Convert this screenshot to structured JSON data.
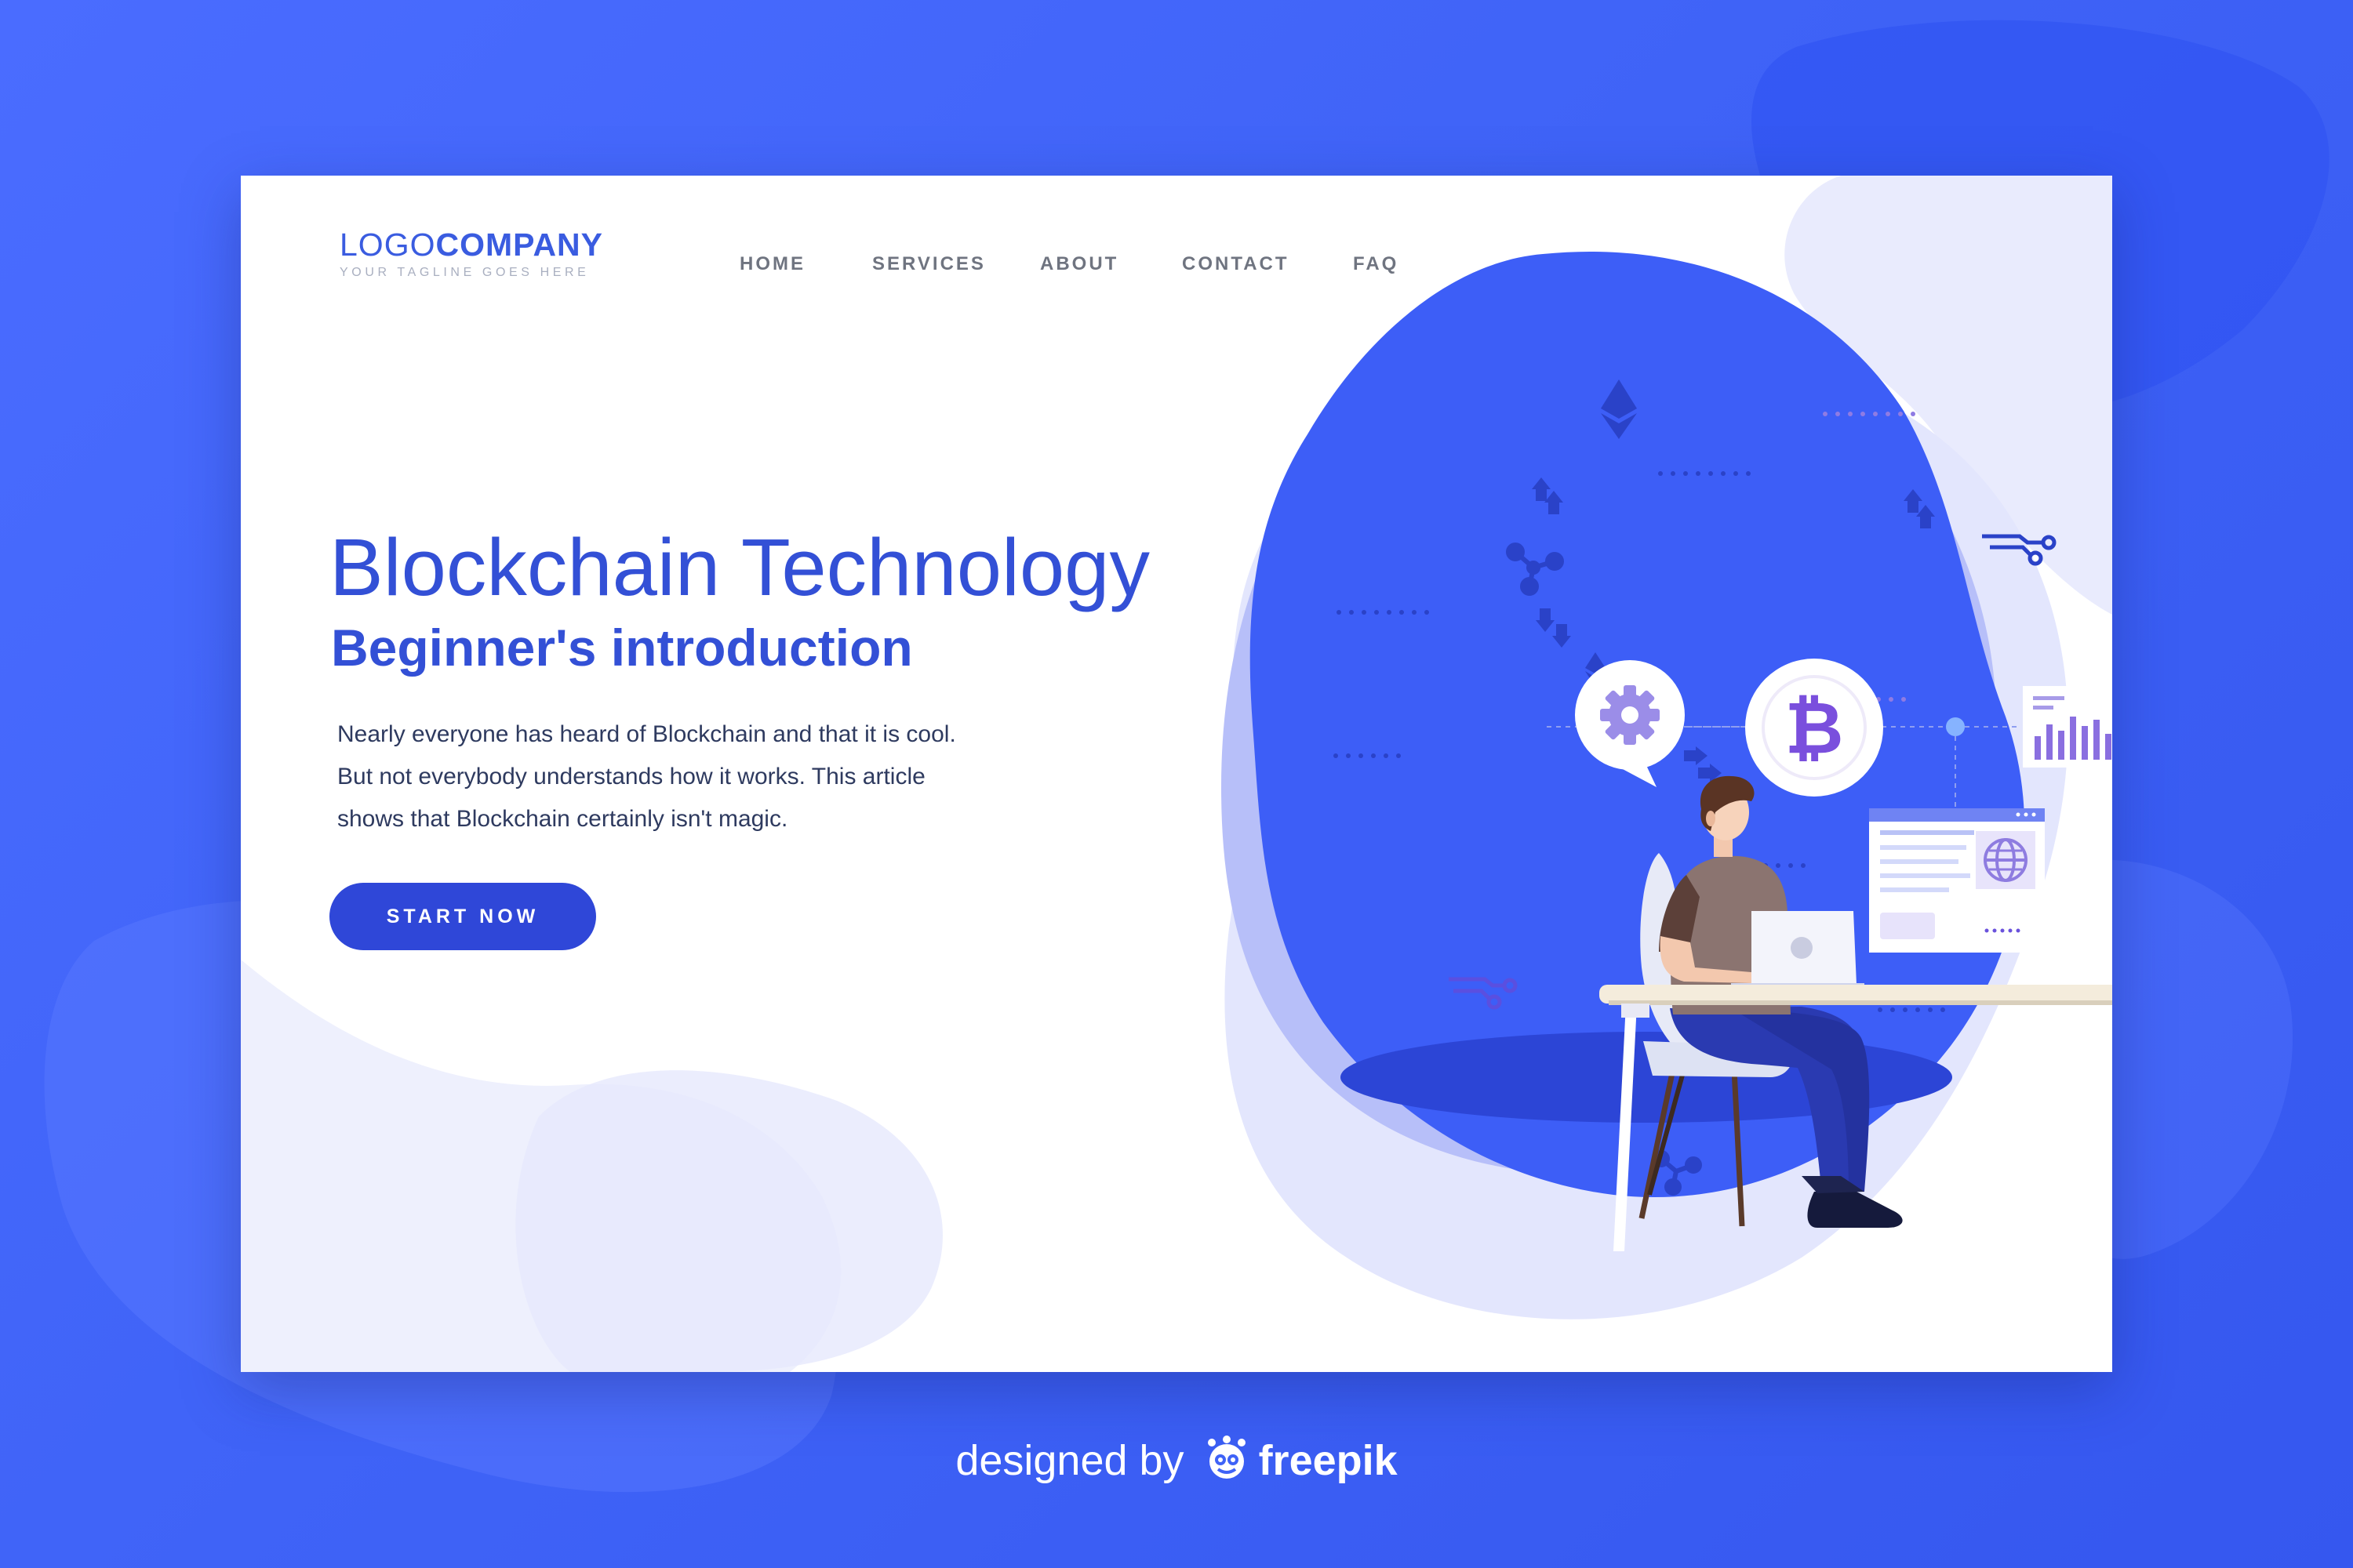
{
  "logo": {
    "light": "LOGO",
    "bold": "COMPANY",
    "tagline": "YOUR TAGLINE GOES HERE"
  },
  "nav": {
    "items": [
      {
        "label": "HOME"
      },
      {
        "label": "SERVICES"
      },
      {
        "label": "ABOUT"
      },
      {
        "label": "CONTACT"
      },
      {
        "label": "FAQ"
      }
    ]
  },
  "hero": {
    "title": "Blockchain Technology",
    "subtitle": "Beginner's introduction",
    "body": "Nearly everyone has heard of Blockchain and that it is cool. But not everybody understands how it works. This article shows that Blockchain certainly isn't magic.",
    "cta": "START NOW"
  },
  "illustration": {
    "coin_symbol": "₿"
  },
  "credit": {
    "prefix": "designed by",
    "brand": "freepik"
  },
  "colors": {
    "background": "#3f63f7",
    "card": "#ffffff",
    "primary": "#3350d6",
    "button": "#2f47d8",
    "nav_text": "#6f7480",
    "blob": "#3d5ef7",
    "blob_light": "#e3e6fd",
    "accent_purple": "#7a4fdd"
  },
  "icons": [
    "gear-icon",
    "bitcoin-icon",
    "bar-chart-icon",
    "globe-icon",
    "ethereum-icon",
    "network-icon",
    "arrow-icon",
    "freepik-logo-icon"
  ]
}
